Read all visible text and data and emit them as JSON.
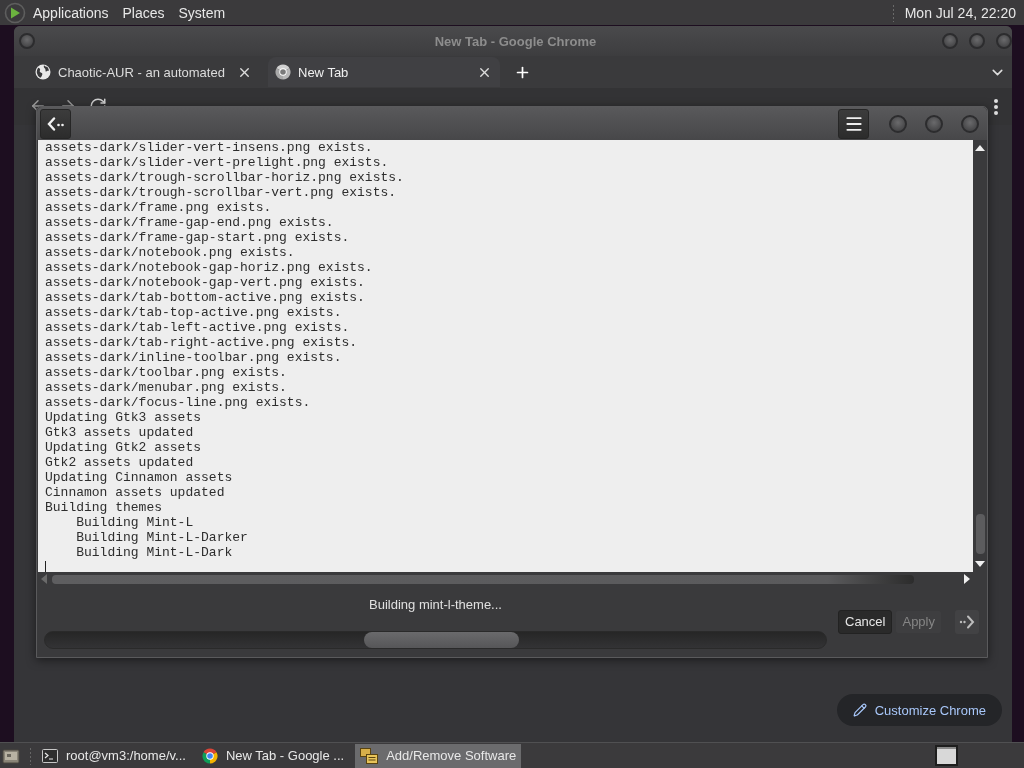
{
  "top_panel": {
    "menus": [
      "Applications",
      "Places",
      "System"
    ],
    "clock": "Mon Jul 24, 22:20"
  },
  "browser": {
    "title": "New Tab - Google Chrome",
    "tabs": [
      {
        "title": "Chaotic-AUR - an automated",
        "kind": "site",
        "selected": false
      },
      {
        "title": "New Tab",
        "kind": "newtab",
        "selected": true
      }
    ],
    "customize_button": "Customize Chrome"
  },
  "dialog": {
    "log_lines": [
      {
        "text": "assets-dark/slider-vert-insens.png exists."
      },
      {
        "text": "assets-dark/slider-vert-prelight.png exists."
      },
      {
        "text": "assets-dark/trough-scrollbar-horiz.png exists."
      },
      {
        "text": "assets-dark/trough-scrollbar-vert.png exists."
      },
      {
        "text": "assets-dark/frame.png exists."
      },
      {
        "text": "assets-dark/frame-gap-end.png exists."
      },
      {
        "text": "assets-dark/frame-gap-start.png exists."
      },
      {
        "text": "assets-dark/notebook.png exists."
      },
      {
        "text": "assets-dark/notebook-gap-horiz.png exists."
      },
      {
        "text": "assets-dark/notebook-gap-vert.png exists."
      },
      {
        "text": "assets-dark/tab-bottom-active.png exists."
      },
      {
        "text": "assets-dark/tab-top-active.png exists."
      },
      {
        "text": "assets-dark/tab-left-active.png exists."
      },
      {
        "text": "assets-dark/tab-right-active.png exists."
      },
      {
        "text": "assets-dark/inline-toolbar.png exists."
      },
      {
        "text": "assets-dark/toolbar.png exists."
      },
      {
        "text": "assets-dark/menubar.png exists."
      },
      {
        "text": "assets-dark/focus-line.png exists."
      },
      {
        "text": "Updating Gtk3 assets"
      },
      {
        "text": "Gtk3 assets updated"
      },
      {
        "text": "Updating Gtk2 assets"
      },
      {
        "text": "Gtk2 assets updated"
      },
      {
        "text": "Updating Cinnamon assets"
      },
      {
        "text": "Cinnamon assets updated"
      },
      {
        "text": "Building themes",
        "children": [
          {
            "text": "Building Mint-L"
          },
          {
            "text": "Building Mint-L-Darker"
          },
          {
            "text": "Building Mint-L-Dark"
          }
        ]
      }
    ],
    "status": "Building mint-l-theme...",
    "buttons": [
      {
        "label": "Cancel",
        "disabled": false
      },
      {
        "label": "Apply",
        "disabled": true
      }
    ]
  },
  "taskbar": {
    "items": [
      {
        "label": "root@vm3:/home/v...",
        "kind": "terminal",
        "selected": false
      },
      {
        "label": "New Tab - Google ...",
        "kind": "browser",
        "selected": false
      },
      {
        "label": "Add/Remove Software",
        "kind": "software",
        "selected": true
      }
    ]
  }
}
